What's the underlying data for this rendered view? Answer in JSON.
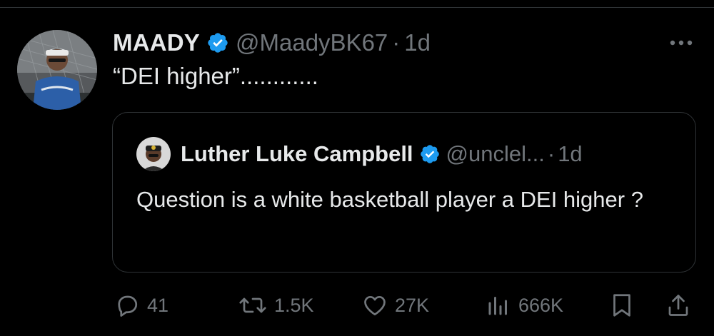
{
  "tweet": {
    "author_name": "MAADY",
    "author_handle": "@MaadyBK67",
    "separator": "·",
    "time": "1d",
    "text": "“DEI higher”............"
  },
  "quoted_tweet": {
    "author_name": "Luther Luke Campbell",
    "author_handle": "@unclel...",
    "separator": "·",
    "time": "1d",
    "text": "Question is a white basketball player a DEI higher ?"
  },
  "actions": {
    "replies": "41",
    "retweets": "1.5K",
    "likes": "27K",
    "views": "666K"
  },
  "colors": {
    "background": "#000000",
    "primary_text": "#e7e9ea",
    "secondary_text": "#71767b",
    "border": "#2f3336",
    "verified_blue": "#1d9bf0"
  },
  "icons": [
    "verified-badge-icon",
    "more-icon",
    "reply-icon",
    "retweet-icon",
    "like-icon",
    "views-icon",
    "bookmark-icon",
    "share-icon"
  ]
}
